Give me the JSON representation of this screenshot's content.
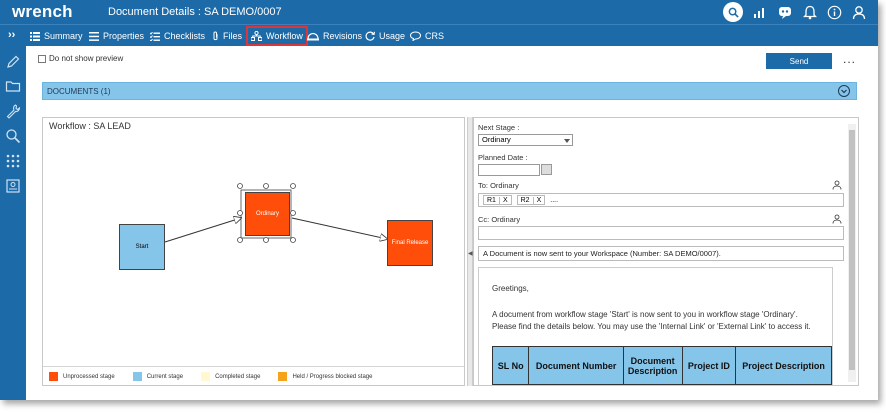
{
  "app": {
    "name": "wrench",
    "title": "Document Details : SA DEMO/0007"
  },
  "tabs": [
    {
      "label": "Summary",
      "icon": "list-icon"
    },
    {
      "label": "Properties",
      "icon": "properties-icon"
    },
    {
      "label": "Checklists",
      "icon": "checklist-icon"
    },
    {
      "label": "Files",
      "icon": "paperclip-icon"
    },
    {
      "label": "Workflow",
      "icon": "workflow-icon",
      "selected": true
    },
    {
      "label": "Revisions",
      "icon": "revisions-icon"
    },
    {
      "label": "Usage",
      "icon": "usage-icon"
    },
    {
      "label": "CRS",
      "icon": "comment-icon"
    }
  ],
  "sidebar_icons": [
    "pencil-icon",
    "folder-icon",
    "wrench-icon",
    "search-icon",
    "grid-icon",
    "report-icon"
  ],
  "toolbar": {
    "preview_label": "Do not show preview",
    "send_label": "Send",
    "more_label": "..."
  },
  "documents_bar": {
    "label": "DOCUMENTS (1)"
  },
  "workflow": {
    "title": "Workflow : SA LEAD",
    "stages": [
      {
        "label": "Start",
        "status": "current"
      },
      {
        "label": "Ordinary",
        "status": "unprocessed"
      },
      {
        "label": "Final Release",
        "status": "unprocessed"
      }
    ],
    "legend": [
      {
        "label": "Unprocessed stage",
        "color": "#ff4d0a"
      },
      {
        "label": "Current stage",
        "color": "#86c5ea"
      },
      {
        "label": "Completed stage",
        "color": "#fff8d0"
      },
      {
        "label": "Held / Progress blocked stage",
        "color": "#f5a31a"
      }
    ]
  },
  "form": {
    "next_stage_label": "Next Stage :",
    "next_stage_value": "Ordinary",
    "planned_date_label": "Planned Date :",
    "to_label": "To: Ordinary",
    "to_recipients": [
      "R1",
      "R2"
    ],
    "remove_label": "X",
    "more_recipients": "....",
    "cc_label": "Cc: Ordinary",
    "subject": "A Document is now sent to your Workspace (Number: SA DEMO/0007).",
    "body": {
      "greeting": "Greetings,",
      "line1": "A document from workflow stage 'Start' is now sent to you in workflow stage 'Ordinary'.",
      "line2": "Please find the details below. You may use the 'Internal Link' or 'External Link' to access it.",
      "table_headers": [
        "SL No",
        "Document Number",
        "Document Description",
        "Project ID",
        "Project Description"
      ]
    }
  },
  "colors": {
    "brand": "#1c6aa8",
    "accent": "#86c5ea",
    "highlight": "#d9363e",
    "unprocessed": "#ff4d0a"
  }
}
